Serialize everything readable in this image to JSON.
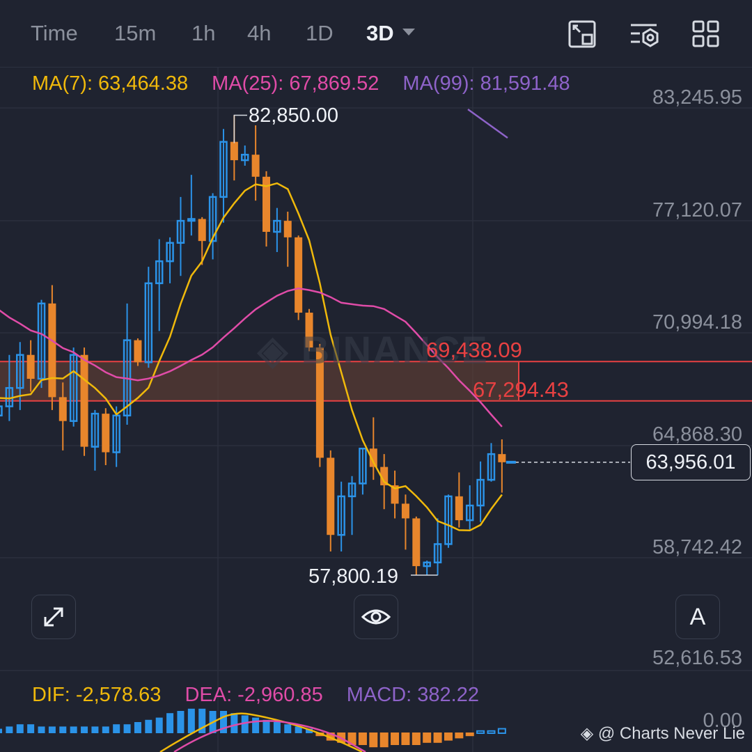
{
  "toolbar": {
    "timeframes": [
      {
        "label": "Time",
        "active": false
      },
      {
        "label": "15m",
        "active": false
      },
      {
        "label": "1h",
        "active": false
      },
      {
        "label": "4h",
        "active": false
      },
      {
        "label": "1D",
        "active": false
      },
      {
        "label": "3D",
        "active": true
      }
    ],
    "icons": [
      "fullscreen-exit-icon",
      "indicator-settings-icon",
      "layout-grid-icon"
    ]
  },
  "legend": {
    "ma7": "MA(7): 63,464.38",
    "ma25": "MA(25): 67,869.52",
    "ma99": "MA(99): 81,591.48"
  },
  "macd_legend": {
    "dif": "DIF: -2,578.63",
    "dea": "DEA: -2,960.85",
    "macd": "MACD: 382.22"
  },
  "y_axis": {
    "ticks": [
      "83,245.95",
      "77,120.07",
      "70,994.18",
      "64,868.30",
      "58,742.42",
      "52,616.53"
    ],
    "macd_zero": "0.00"
  },
  "price": {
    "current": "63,956.01",
    "high_label": "82,850.00",
    "low_label": "57,800.19"
  },
  "zone": {
    "upper": "69,438.09",
    "lower": "67,294.43"
  },
  "watermark": "BINANCE",
  "credit": "@ Charts Never Lie",
  "floating": {
    "font_button": "A"
  },
  "colors": {
    "up": "#2b93e8",
    "down": "#e8862c",
    "ma7": "#f0b90b",
    "ma25": "#e04ca8",
    "ma99": "#8e63c9",
    "zone": "#e84142",
    "background": "#1f2330"
  },
  "chart_data": {
    "type": "candlestick",
    "ylim": [
      52616.53,
      83245.95
    ],
    "candles": [
      [
        66500,
        67200,
        65800,
        67000
      ],
      [
        67000,
        69800,
        66200,
        68000
      ],
      [
        68000,
        70500,
        66800,
        69800
      ],
      [
        69800,
        70600,
        67800,
        68500
      ],
      [
        68500,
        72800,
        68000,
        72600
      ],
      [
        72600,
        73600,
        66800,
        67500
      ],
      [
        67500,
        68300,
        64600,
        66200
      ],
      [
        66200,
        70200,
        65900,
        69800
      ],
      [
        69800,
        70200,
        64300,
        64800
      ],
      [
        64800,
        66800,
        63500,
        66600
      ],
      [
        66600,
        66900,
        63800,
        64500
      ],
      [
        64500,
        67000,
        63700,
        66500
      ],
      [
        66500,
        72600,
        66000,
        70600
      ],
      [
        70600,
        70700,
        69200,
        69400
      ],
      [
        69400,
        74600,
        69100,
        73700
      ],
      [
        73700,
        76100,
        71100,
        74900
      ],
      [
        74900,
        76200,
        73700,
        75900
      ],
      [
        75900,
        78400,
        74100,
        77100
      ],
      [
        77100,
        79600,
        76300,
        77200
      ],
      [
        77200,
        77300,
        74700,
        76000
      ],
      [
        76000,
        78600,
        75000,
        78400
      ],
      [
        78400,
        82100,
        77000,
        81400
      ],
      [
        81400,
        82850,
        79300,
        80400
      ],
      [
        80400,
        81200,
        80100,
        80700
      ],
      [
        80700,
        82300,
        78200,
        79500
      ],
      [
        79500,
        79800,
        75700,
        76500
      ],
      [
        76500,
        77800,
        75400,
        77100
      ],
      [
        77100,
        77600,
        74600,
        76200
      ],
      [
        76200,
        76300,
        71700,
        72100
      ],
      [
        72100,
        72300,
        70000,
        70200
      ],
      [
        70200,
        70400,
        63700,
        64200
      ],
      [
        64200,
        64600,
        59100,
        60000
      ],
      [
        60000,
        62900,
        59100,
        62100
      ],
      [
        62100,
        63200,
        60000,
        62800
      ],
      [
        62800,
        64700,
        62200,
        64700
      ],
      [
        64700,
        66400,
        63000,
        63700
      ],
      [
        63700,
        64400,
        61400,
        62700
      ],
      [
        62700,
        63500,
        60900,
        61700
      ],
      [
        61700,
        62200,
        59200,
        60900
      ],
      [
        60900,
        61000,
        57800,
        58300
      ],
      [
        58300,
        58600,
        57800,
        58500
      ],
      [
        58500,
        60900,
        57800,
        59500
      ],
      [
        59500,
        62200,
        59300,
        62100
      ],
      [
        62100,
        63400,
        60400,
        60800
      ],
      [
        60800,
        62700,
        60300,
        61600
      ],
      [
        61600,
        64000,
        60700,
        63000
      ],
      [
        63000,
        65000,
        62900,
        64400
      ],
      [
        64400,
        65200,
        62300,
        63956.01
      ]
    ],
    "ma7_last": 63464.38,
    "ma25_last": 67869.52,
    "ma99_last": 81591.48,
    "annotations": {
      "high": 82850.0,
      "low": 57800.19,
      "zone_upper": 69438.09,
      "zone_lower": 67294.43,
      "current": 63956.01
    },
    "macd": {
      "dif": -2578.63,
      "dea": -2960.85,
      "macd": 382.22
    },
    "macd_histogram": [
      2,
      3,
      4,
      4,
      3,
      3,
      3,
      3,
      3,
      3,
      3,
      4,
      4,
      5,
      6,
      7,
      9,
      10,
      11,
      11,
      10,
      10,
      9,
      8,
      7,
      6,
      5,
      4,
      3,
      2,
      -1,
      -3,
      -4,
      -5,
      -5,
      -6,
      -6,
      -5,
      -5,
      -5,
      -4,
      -4,
      -3,
      -2,
      -1,
      1,
      1,
      2
    ]
  }
}
